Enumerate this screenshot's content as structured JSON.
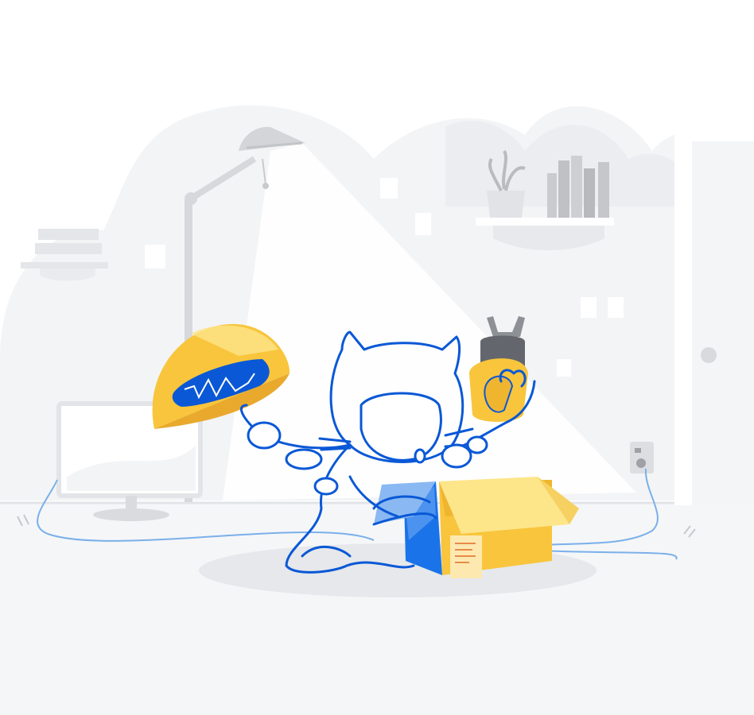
{
  "scene": {
    "description_visible_text": "",
    "elements": {
      "octocat": "octocat-outline",
      "lamp": "floor-lamp",
      "box": "unboxing-box",
      "monitor": "monitor",
      "shelf": "wall-shelf",
      "door": "door",
      "outlet": "wall-outlet",
      "helmet": "yellow-helmet",
      "plug": "power-plug"
    }
  },
  "colors": {
    "background": "#ffffff",
    "wall": "#f1f3f5",
    "floor": "#f5f6f8",
    "shape": "#e7e9ec",
    "line": "#0a58d6",
    "yellow": "#f8c53c",
    "yellow_dark": "#e8a92d",
    "yellow_light": "#fde58a",
    "blue_box": "#1a73e8",
    "cable": "#6fa6e8",
    "gray": "#bdbfc3"
  }
}
